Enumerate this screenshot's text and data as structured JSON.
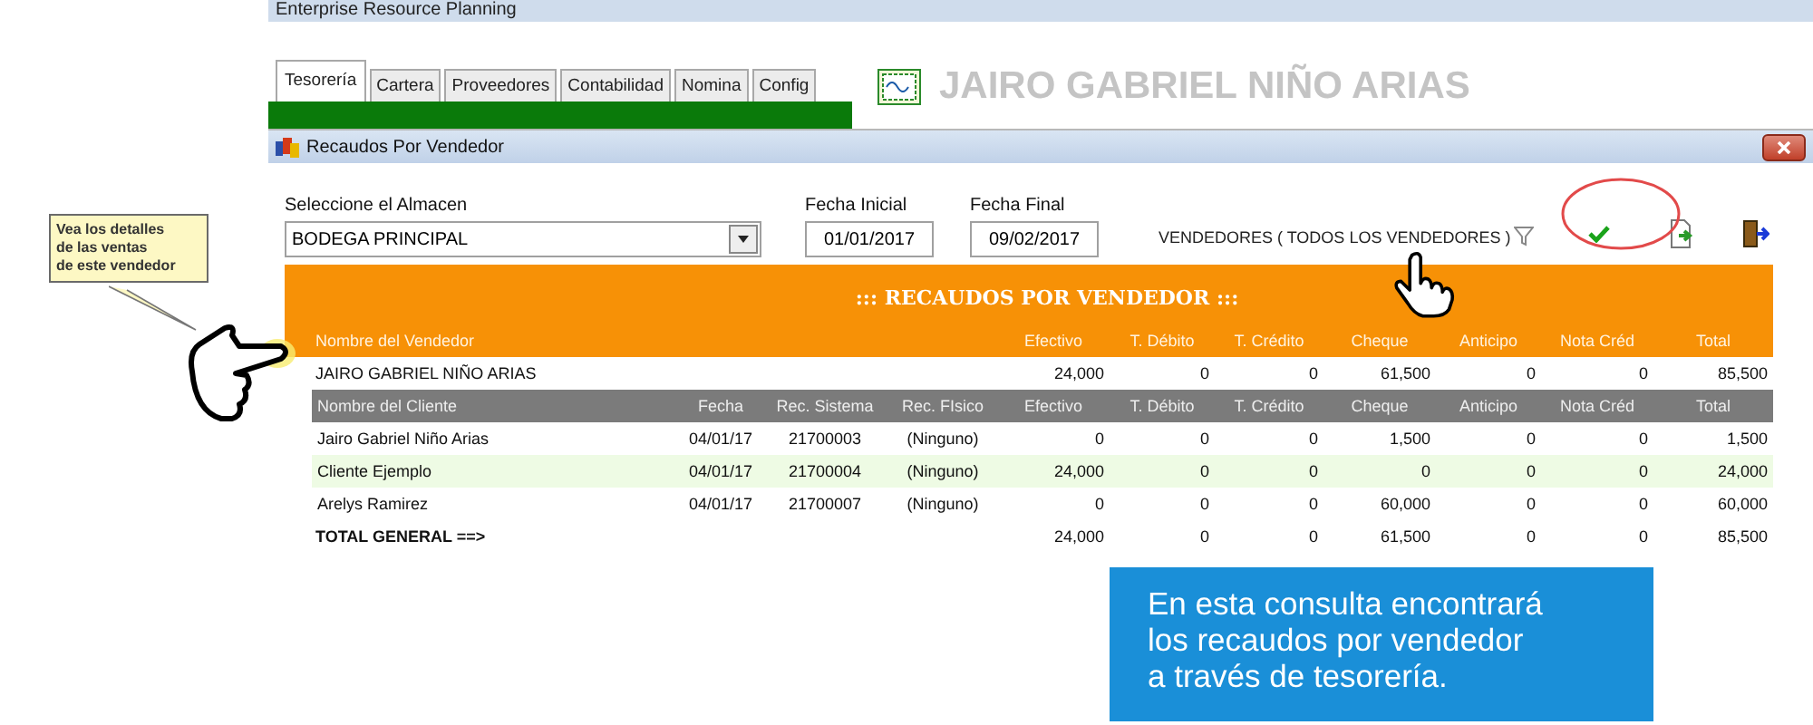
{
  "window": {
    "title": "Enterprise Resource Planning"
  },
  "tabs": [
    {
      "label": "Tesorería",
      "selected": true
    },
    {
      "label": "Cartera",
      "selected": false
    },
    {
      "label": "Proveedores",
      "selected": false
    },
    {
      "label": "Contabilidad",
      "selected": false
    },
    {
      "label": "Nomina",
      "selected": false
    },
    {
      "label": "Config",
      "selected": false
    }
  ],
  "company_name": "JAIRO GABRIEL NIÑO ARIAS",
  "subwindow": {
    "title": "Recaudos Por Vendedor"
  },
  "almacen": {
    "label": "Seleccione el Almacen",
    "value": "BODEGA PRINCIPAL"
  },
  "fecha_inicial": {
    "label": "Fecha Inicial",
    "value": "01/01/2017"
  },
  "fecha_final": {
    "label": "Fecha Final",
    "value": "09/02/2017"
  },
  "vendor_filter": "VENDEDORES ( TODOS LOS VENDEDORES )",
  "report": {
    "title": "::: RECAUDOS POR VENDEDOR :::",
    "vendor_columns": [
      "Nombre del Vendedor",
      "Efectivo",
      "T. Débito",
      "T. Crédito",
      "Cheque",
      "Anticipo",
      "Nota Créd",
      "Total"
    ],
    "vendors": [
      {
        "name": "JAIRO GABRIEL NIÑO ARIAS",
        "values": [
          "24,000",
          "0",
          "0",
          "61,500",
          "0",
          "0",
          "85,500"
        ]
      }
    ],
    "client_columns": [
      "Nombre del Cliente",
      "Fecha",
      "Rec. Sistema",
      "Rec. FIsico",
      "Efectivo",
      "T. Débito",
      "T. Crédito",
      "Cheque",
      "Anticipo",
      "Nota Créd",
      "Total"
    ],
    "clients": [
      {
        "cells": [
          "Jairo Gabriel Niño Arias",
          "04/01/17",
          "21700003",
          "(Ninguno)",
          "0",
          "0",
          "0",
          "1,500",
          "0",
          "0",
          "1,500"
        ]
      },
      {
        "cells": [
          "Cliente Ejemplo",
          "04/01/17",
          "21700004",
          "(Ninguno)",
          "24,000",
          "0",
          "0",
          "0",
          "0",
          "0",
          "24,000"
        ]
      },
      {
        "cells": [
          "Arelys Ramirez",
          "04/01/17",
          "21700007",
          "(Ninguno)",
          "0",
          "0",
          "0",
          "60,000",
          "0",
          "0",
          "60,000"
        ]
      }
    ],
    "total": {
      "label": "TOTAL GENERAL ==>",
      "values": [
        "24,000",
        "0",
        "0",
        "61,500",
        "0",
        "0",
        "85,500"
      ]
    }
  },
  "callout": "Vea los detalles\nde las ventas\nde este vendedor",
  "info_box": "En esta consulta encontrará\nlos recaudos por vendedor\na través de tesorería."
}
